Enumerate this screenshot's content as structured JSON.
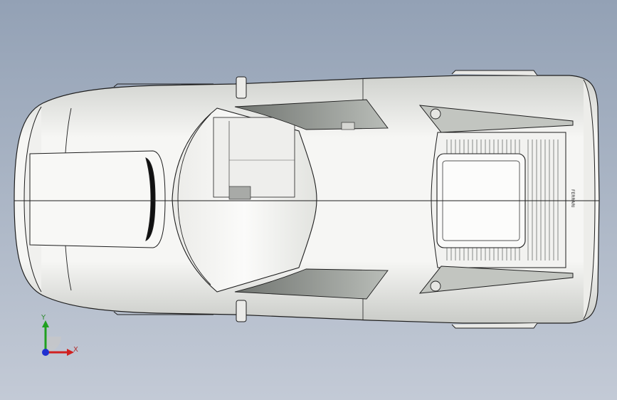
{
  "viewport": {
    "background_top": "#93a1b5",
    "background_bottom": "#c3cad6"
  },
  "model": {
    "body_color": "#f4f4f2",
    "edge_color": "#1e1e1e",
    "glass_color": "#d9ddd8",
    "shade_color": "#8a8e8a",
    "badge_text": "FERRARI"
  },
  "triad": {
    "x_label": "X",
    "y_label": "Y",
    "x_color": "#d02020",
    "y_color": "#20a020",
    "z_color": "#2030d0"
  }
}
